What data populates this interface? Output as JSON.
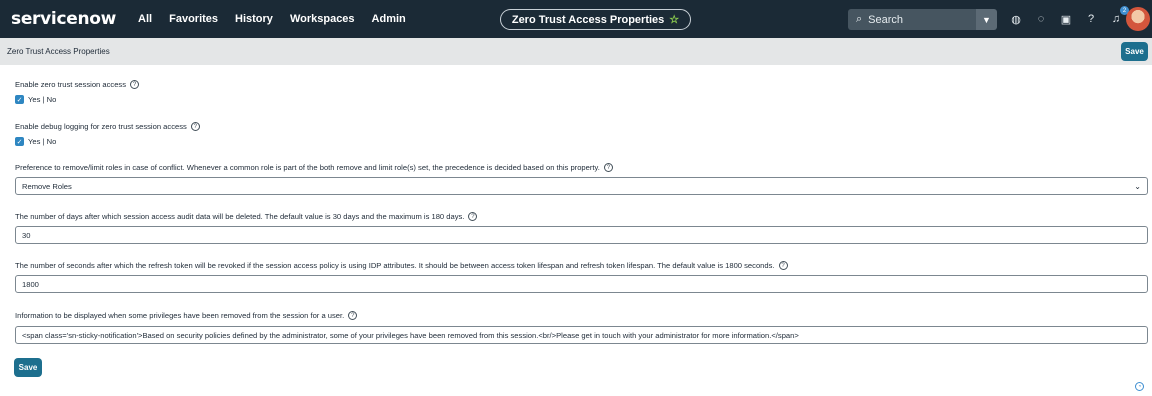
{
  "nav": {
    "logo": "servicenow",
    "links": [
      "All",
      "Favorites",
      "History",
      "Workspaces",
      "Admin"
    ],
    "page_title": "Zero Trust Access Properties",
    "search_placeholder": "Search",
    "notification_count": "2",
    "icons": [
      "globe-icon",
      "chat-icon",
      "screen-icon",
      "help-icon",
      "bell-icon"
    ]
  },
  "header": {
    "title": "Zero Trust Access Properties",
    "save_label": "Save"
  },
  "fields": {
    "zero_trust": {
      "label": "Enable zero trust session access",
      "checked": true,
      "option_label": "Yes | No"
    },
    "debug_logging": {
      "label": "Enable debug logging for zero trust session access",
      "checked": true,
      "option_label": "Yes | No"
    },
    "preference": {
      "label": "Preference to remove/limit roles in case of conflict. Whenever a common role is part of the both remove and limit role(s) set, the precedence is decided based on this property.",
      "value": "Remove Roles"
    },
    "audit_days": {
      "label": "The number of days after which session access audit data will be deleted. The default value is 30 days and the maximum is 180 days.",
      "value": "30"
    },
    "refresh_seconds": {
      "label": "The number of seconds after which the refresh token will be revoked if the session access policy is using IDP attributes. It should be between access token lifespan and refresh token lifespan. The default value is 1800 seconds.",
      "value": "1800"
    },
    "info_message": {
      "label": "Information to be displayed when some privileges have been removed from the session for a user.",
      "value": "<span class='sn-sticky-notification'>Based on security policies defined by the administrator, some of your privileges have been removed from this session.<br/>Please get in touch with your administrator for more information.</span>"
    }
  },
  "footer": {
    "save_label": "Save"
  },
  "colors": {
    "nav_bg": "#1b2a36",
    "accent": "#1d6f8e",
    "header_bg": "#e4e6e7",
    "checkbox": "#2e86c1"
  }
}
